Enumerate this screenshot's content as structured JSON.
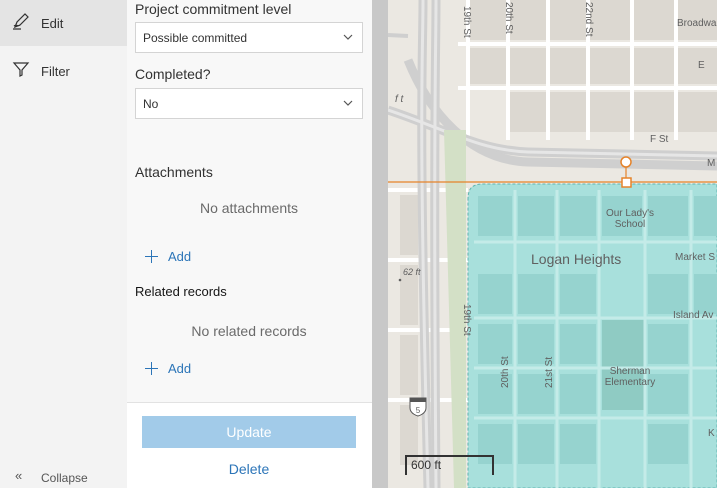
{
  "rail": {
    "items": [
      {
        "label": "Edit",
        "icon": "edit-icon",
        "active": true
      },
      {
        "label": "Filter",
        "icon": "filter-icon",
        "active": false
      }
    ],
    "collapse_label": "Collapse"
  },
  "form": {
    "commitment": {
      "label": "Project commitment level",
      "value": "Possible committed"
    },
    "completed": {
      "label": "Completed?",
      "value": "No"
    },
    "attachments": {
      "title": "Attachments",
      "empty": "No attachments",
      "add": "Add"
    },
    "related": {
      "title": "Related records",
      "empty": "No related records",
      "add": "Add"
    }
  },
  "footer": {
    "update_label": "Update",
    "delete_label": "Delete"
  },
  "map": {
    "neighborhood_label": "Logan Heights",
    "place_labels": [
      "Our Lady's",
      "School",
      "Sherman",
      "Elementary",
      "Market S",
      "Island Av",
      "K"
    ],
    "street_labels": [
      "19th St",
      "20th St",
      "22nd St",
      "Broadwa",
      "E",
      "F St",
      "M",
      "19th St",
      "20th St",
      "21st St"
    ],
    "elevation_labels": [
      "62 ft",
      "f t"
    ],
    "highway_shield": "5",
    "scale_label": "600 ft",
    "colors": {
      "land": "#ebe8e2",
      "road": "#ffffff",
      "highway": "#c9c9c9",
      "highlight_fill": "#a8e0dc",
      "selection": "#e5832a"
    }
  }
}
